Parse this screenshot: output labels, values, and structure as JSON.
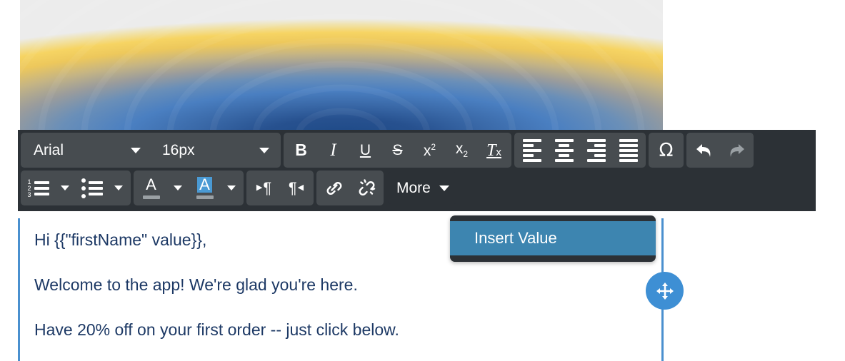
{
  "hero": {
    "name": "banner-gradient-image",
    "colors": [
      "#f6d463",
      "#e9e6dc",
      "#4a7fc1",
      "#27518f",
      "#ececec"
    ]
  },
  "toolbar": {
    "font_family": {
      "label": "Arial",
      "icon": "chevron-down-icon"
    },
    "font_size": {
      "label": "16px",
      "icon": "chevron-down-icon"
    },
    "bold": {
      "label": "B",
      "title": "Bold"
    },
    "italic": {
      "label": "I",
      "title": "Italic"
    },
    "underline": {
      "label": "U",
      "title": "Underline"
    },
    "strikethrough": {
      "label": "S",
      "title": "Strikethrough"
    },
    "superscript": {
      "label": "x",
      "sup": "2",
      "title": "Superscript"
    },
    "subscript": {
      "label": "x",
      "sub": "2",
      "title": "Subscript"
    },
    "remove_format": {
      "label": "T",
      "sub": "x",
      "title": "Remove Format"
    },
    "align_left": {
      "title": "Align Left"
    },
    "align_center": {
      "title": "Align Center"
    },
    "align_right": {
      "title": "Align Right"
    },
    "align_justify": {
      "title": "Justify"
    },
    "special_char": {
      "label": "Ω",
      "title": "Insert Special Character"
    },
    "undo": {
      "label": "↶",
      "title": "Undo",
      "state": "enabled"
    },
    "redo": {
      "label": "↷",
      "title": "Redo",
      "state": "disabled"
    },
    "numbered_list": {
      "markers": [
        "1",
        "2",
        "3"
      ],
      "title": "Numbered List"
    },
    "bulleted_list": {
      "title": "Bulleted List"
    },
    "text_color": {
      "label": "A",
      "title": "Text Color",
      "swatch": "#9aa0a4"
    },
    "background_color": {
      "label": "A",
      "title": "Background Color",
      "swatch": "#4a9ad4"
    },
    "ltr": {
      "title": "Left to Right"
    },
    "rtl": {
      "title": "Right to Left"
    },
    "link": {
      "label": "🔗",
      "title": "Link"
    },
    "unlink": {
      "title": "Unlink"
    },
    "more": {
      "label": "More",
      "icon": "chevron-down-icon",
      "state": "pressed"
    }
  },
  "more_menu": {
    "items": [
      {
        "label": "Insert Value",
        "highlighted": true
      }
    ]
  },
  "editor": {
    "paragraphs": [
      "Hi {{\"firstName\" value}},",
      "Welcome to the app! We're glad you're here.",
      "Have 20% off on your first order -- just click below."
    ],
    "text_color": "#1d3965",
    "border_color": "#4a90cf"
  },
  "drag_handle": {
    "name": "move-handle",
    "icon": "move-arrows-icon",
    "color": "#3e8fd4"
  }
}
